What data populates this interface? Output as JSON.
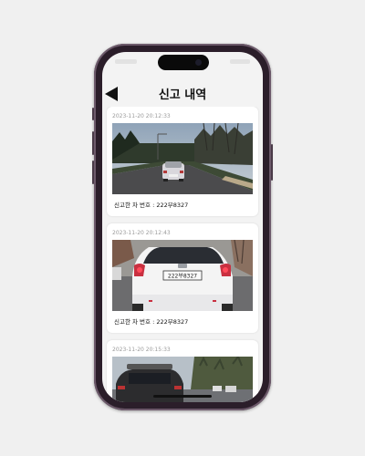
{
  "header": {
    "title": "신고 내역"
  },
  "reports": [
    {
      "timestamp": "2023-11-20 20:12:33",
      "caption": "신고한 차 번호 : 222부8327"
    },
    {
      "timestamp": "2023-11-20 20:12:43",
      "caption": "신고한 차 번호 : 222부8327"
    },
    {
      "timestamp": "2023-11-20 20:15:33",
      "caption": ""
    }
  ]
}
